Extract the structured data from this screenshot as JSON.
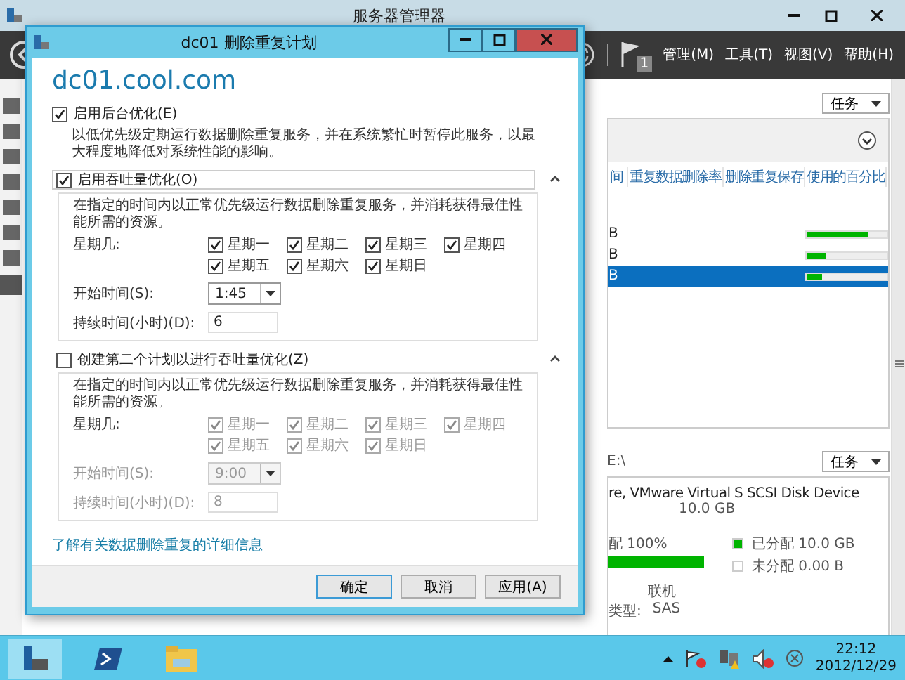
{
  "background_window": {
    "title": "服务器管理器",
    "menus": [
      "管理(M)",
      "工具(T)",
      "视图(V)",
      "帮助(H)"
    ],
    "notification_count": "1",
    "volumes": {
      "tasks": "任务",
      "columns": [
        "间",
        "重复数据删除率",
        "删除重复保存",
        "使用的百分比"
      ],
      "rows": [
        {
          "column_1": "B",
          "level": 0.78,
          "selected": false
        },
        {
          "column_1": "B",
          "level": 0.25,
          "selected": false
        },
        {
          "column_1": "B",
          "level": 0.2,
          "selected": true
        }
      ]
    },
    "disk": {
      "path": "E:\\",
      "tasks": "任务",
      "name": "re, VMware Virtual S SCSI Disk Device",
      "size": "10.0 GB",
      "allocation": "配 100%",
      "level": 1,
      "legend": [
        {
          "label": "已分配 10.0 GB",
          "color": "#00b400"
        },
        {
          "label": "未分配 0.00 B",
          "color": "#ffffff"
        }
      ],
      "status": "联机",
      "type_label": "类型:",
      "type": "SAS"
    }
  },
  "dialog": {
    "title": "dc01 删除重复计划",
    "server": "dc01.cool.com",
    "background": {
      "label": "启用后台优化(E)",
      "checked": true,
      "description": "以低优先级定期运行数据删除重复服务，并在系统繁忙时暂停此服务，以最大程度地降低对系统性能的影响。"
    },
    "schedules": [
      {
        "label": "启用吞吐量优化(O)",
        "checked": true,
        "expanded": true,
        "description": "在指定的时间内以正常优先级运行数据删除重复服务，并消耗获得最佳性能所需的资源。",
        "days_label": "星期几:",
        "days": [
          {
            "label": "星期一",
            "checked": true
          },
          {
            "label": "星期二",
            "checked": true
          },
          {
            "label": "星期三",
            "checked": true
          },
          {
            "label": "星期四",
            "checked": true
          },
          {
            "label": "星期五",
            "checked": true
          },
          {
            "label": "星期六",
            "checked": true
          },
          {
            "label": "星期日",
            "checked": true
          }
        ],
        "start_label": "开始时间(S):",
        "start": "1:45",
        "duration_label": "持续时间(小时)(D):",
        "duration": "6"
      },
      {
        "label": "创建第二个计划以进行吞吐量优化(Z)",
        "checked": false,
        "expanded": true,
        "description": "在指定的时间内以正常优先级运行数据删除重复服务，并消耗获得最佳性能所需的资源。",
        "days_label": "星期几:",
        "days": [
          {
            "label": "星期一",
            "checked": true
          },
          {
            "label": "星期二",
            "checked": true
          },
          {
            "label": "星期三",
            "checked": true
          },
          {
            "label": "星期四",
            "checked": true
          },
          {
            "label": "星期五",
            "checked": true
          },
          {
            "label": "星期六",
            "checked": true
          },
          {
            "label": "星期日",
            "checked": true
          }
        ],
        "start_label": "开始时间(S):",
        "start": "9:00",
        "duration_label": "持续时间(小时)(D):",
        "duration": "8"
      }
    ],
    "link": "了解有关数据删除重复的详细信息",
    "buttons": [
      "确定",
      "取消",
      "应用(A)"
    ]
  },
  "taskbar": {
    "time": "22:12",
    "date": "2012/12/29"
  }
}
